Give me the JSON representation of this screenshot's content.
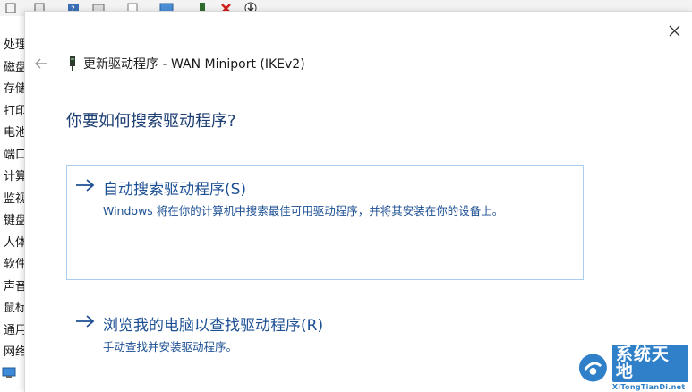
{
  "background_window": {
    "tree_items": [
      "处理",
      "磁盘",
      "存储",
      "打印",
      "电池",
      "端口",
      "计算",
      "监视",
      "键盘",
      "人体",
      "软件",
      "声音",
      "鼠标",
      "通用",
      "网络"
    ]
  },
  "dialog": {
    "title": "更新驱动程序 - WAN Miniport (IKEv2)",
    "question": "你要如何搜索驱动程序?",
    "options": [
      {
        "title": "自动搜索驱动程序(S)",
        "description": "Windows 将在你的计算机中搜索最佳可用驱动程序，并将其安装在你的设备上。"
      },
      {
        "title": "浏览我的电脑以查找驱动程序(R)",
        "description": "手动查找并安装驱动程序。"
      }
    ]
  },
  "watermark": {
    "title": "系统天地",
    "subtitle": "XiTongTianDi.net"
  },
  "colors": {
    "link_blue": "#1c4f93",
    "heading_blue": "#1e3f73",
    "option_border": "#a8cdf0",
    "watermark_blue": "#2f80c8"
  },
  "icons": {
    "close": "close-icon",
    "back": "back-arrow-icon",
    "device": "device-icon",
    "option_arrow": "arrow-right-icon"
  }
}
